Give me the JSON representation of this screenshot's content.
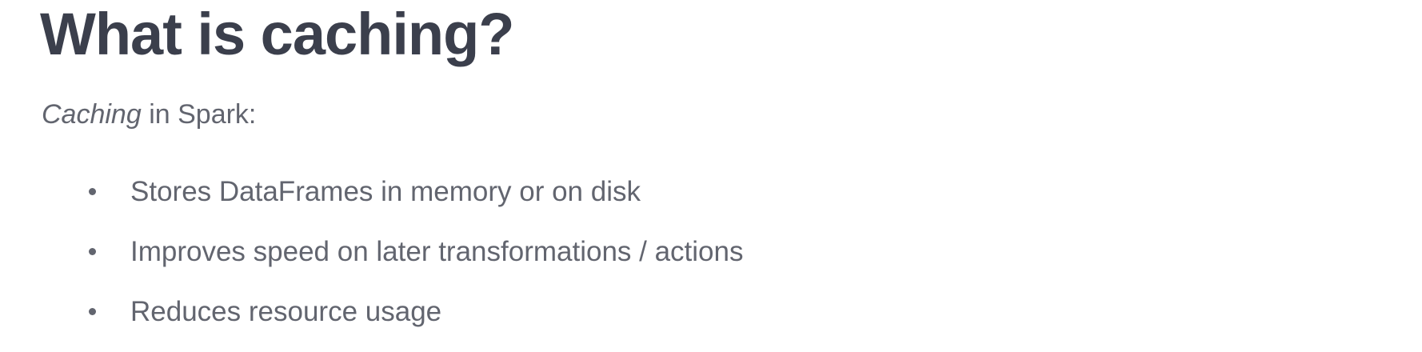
{
  "slide": {
    "title": "What is caching?",
    "intro": {
      "emphasis": "Caching",
      "rest": " in Spark:"
    },
    "bullets": [
      "Stores DataFrames in memory or on disk",
      "Improves speed on later transformations / actions",
      "Reduces resource usage"
    ]
  },
  "colors": {
    "title": "#3b3f4c",
    "body": "#62656f",
    "background": "#ffffff"
  }
}
